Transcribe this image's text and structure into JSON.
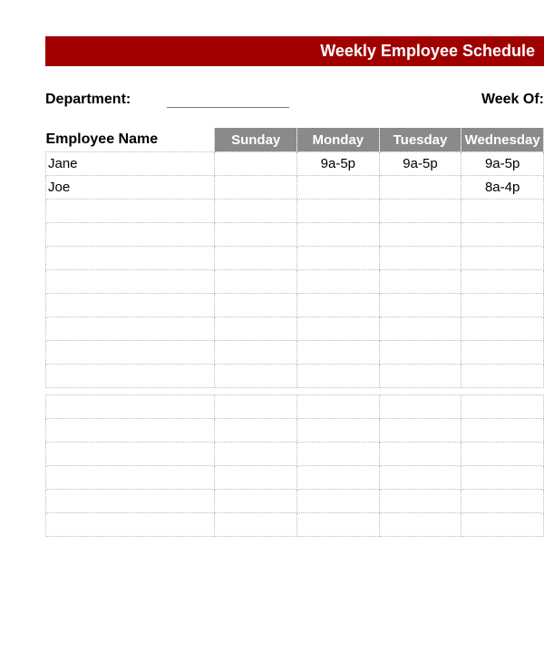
{
  "title": "Weekly Employee Schedule",
  "labels": {
    "department": "Department:",
    "week_of": "Week Of:"
  },
  "fields": {
    "department_value": "",
    "week_of_value": ""
  },
  "columns": {
    "name": "Employee Name",
    "days": [
      "Sunday",
      "Monday",
      "Tuesday",
      "Wednesday"
    ]
  },
  "rows": [
    {
      "name": "Jane",
      "cells": [
        "",
        "9a-5p",
        "9a-5p",
        "9a-5p"
      ]
    },
    {
      "name": "Joe",
      "cells": [
        "",
        "",
        "",
        "8a-4p"
      ]
    },
    {
      "name": "",
      "cells": [
        "",
        "",
        "",
        ""
      ]
    },
    {
      "name": "",
      "cells": [
        "",
        "",
        "",
        ""
      ]
    },
    {
      "name": "",
      "cells": [
        "",
        "",
        "",
        ""
      ]
    },
    {
      "name": "",
      "cells": [
        "",
        "",
        "",
        ""
      ]
    },
    {
      "name": "",
      "cells": [
        "",
        "",
        "",
        ""
      ]
    },
    {
      "name": "",
      "cells": [
        "",
        "",
        "",
        ""
      ]
    },
    {
      "name": "",
      "cells": [
        "",
        "",
        "",
        ""
      ]
    },
    {
      "name": "",
      "cells": [
        "",
        "",
        "",
        ""
      ]
    },
    {
      "name": "",
      "cells": [
        "",
        "",
        "",
        ""
      ]
    },
    {
      "name": "",
      "cells": [
        "",
        "",
        "",
        ""
      ]
    },
    {
      "name": "",
      "cells": [
        "",
        "",
        "",
        ""
      ]
    },
    {
      "name": "",
      "cells": [
        "",
        "",
        "",
        ""
      ]
    },
    {
      "name": "",
      "cells": [
        "",
        "",
        "",
        ""
      ]
    },
    {
      "name": "",
      "cells": [
        "",
        "",
        "",
        ""
      ]
    }
  ],
  "gap_after_index": 9
}
